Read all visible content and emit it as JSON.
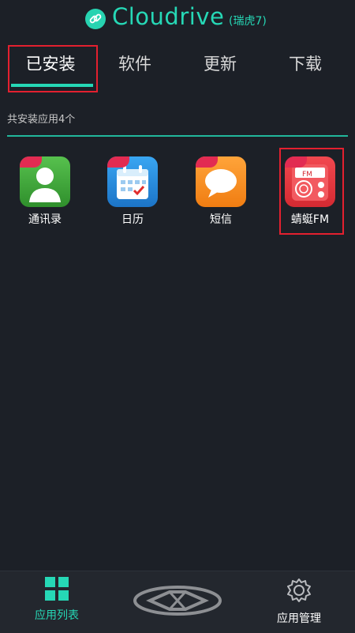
{
  "header": {
    "title": "Cloudrive",
    "subtitle": "(瑞虎7)"
  },
  "tabs": [
    {
      "label": "已安装",
      "active": true
    },
    {
      "label": "软件",
      "active": false
    },
    {
      "label": "更新",
      "active": false
    },
    {
      "label": "下载",
      "active": false
    }
  ],
  "installed": {
    "count_label": "共安装应用4个",
    "apps": [
      {
        "name": "通讯录",
        "icon": "contacts-icon"
      },
      {
        "name": "日历",
        "icon": "calendar-icon"
      },
      {
        "name": "短信",
        "icon": "messages-icon"
      },
      {
        "name": "蜻蜓FM",
        "icon": "radio-fm-icon",
        "icon_text": "FM"
      }
    ]
  },
  "bottom_nav": {
    "left_label": "应用列表",
    "right_label": "应用管理"
  },
  "colors": {
    "accent": "#26d8b6",
    "background": "#1c2027",
    "highlight_box": "#e3202f"
  }
}
